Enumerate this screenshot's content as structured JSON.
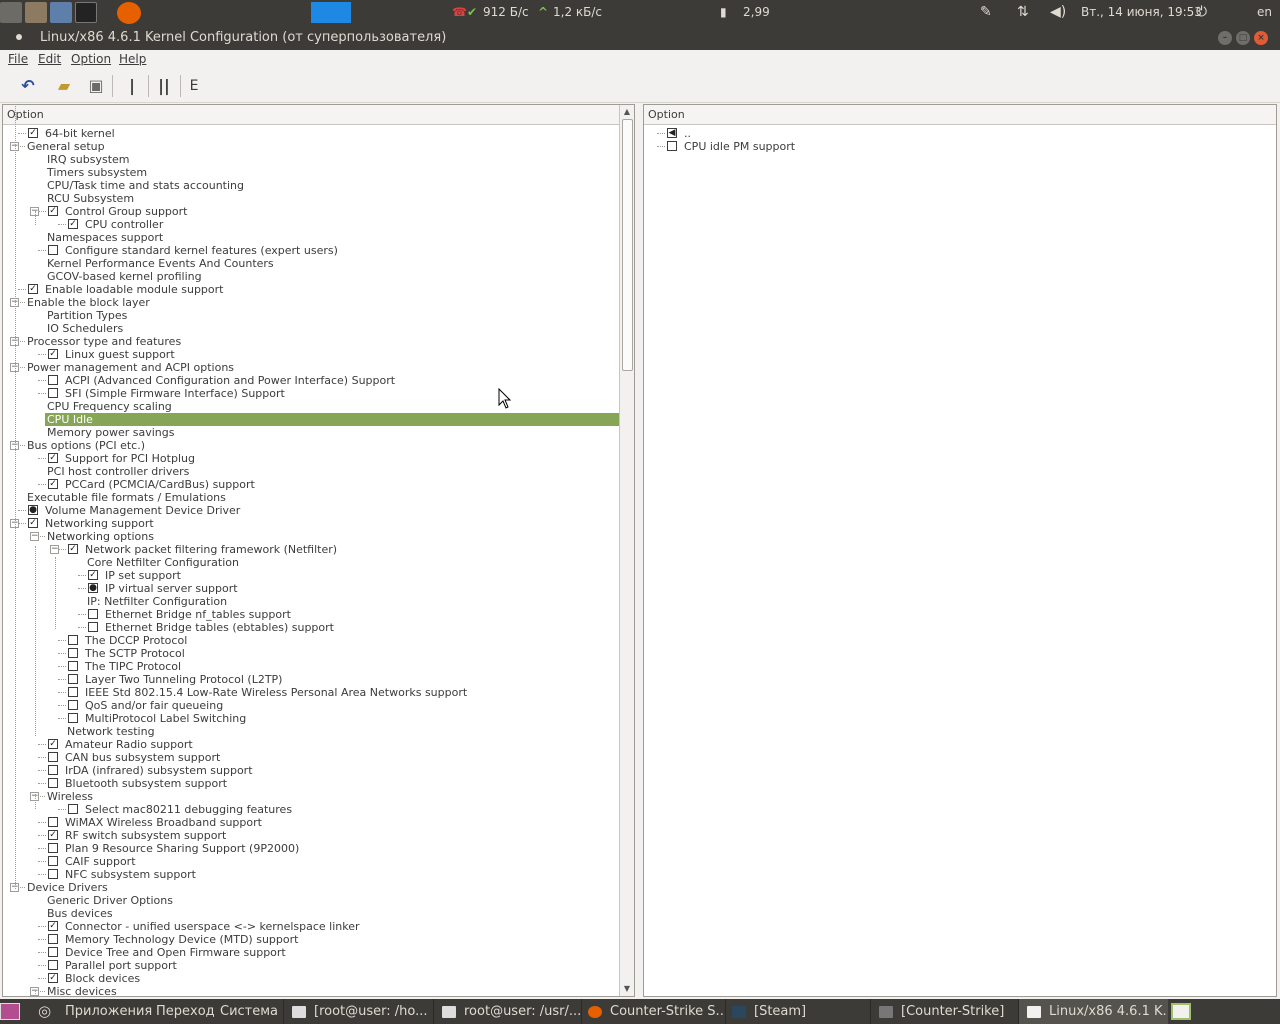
{
  "top_panel": {
    "net_down": "912 Б/с",
    "net_up": "1,2 кБ/с",
    "load": "2,99",
    "datetime": "Вт., 14 июня, 19:53",
    "keyboard_layout": "en"
  },
  "window": {
    "title": "Linux/x86 4.6.1 Kernel Configuration (от суперпользователя)"
  },
  "menu": {
    "file": "File",
    "edit": "Edit",
    "option": "Option",
    "help": "Help"
  },
  "toolbar": {
    "back": "back-arrow-icon",
    "load": "open-folder-icon",
    "save": "save-disk-icon",
    "single": "single-view-icon",
    "split": "split-view-icon",
    "full": "full-view-icon"
  },
  "left_pane": {
    "header": "Option",
    "rows": [
      {
        "label": "64-bit kernel",
        "check": "checked"
      },
      {
        "label": "General setup",
        "check": "none"
      },
      {
        "label": "IRQ subsystem",
        "check": "none"
      },
      {
        "label": "Timers subsystem",
        "check": "none"
      },
      {
        "label": "CPU/Task time and stats accounting",
        "check": "none"
      },
      {
        "label": "RCU Subsystem",
        "check": "none"
      },
      {
        "label": "Control Group support",
        "check": "checked"
      },
      {
        "label": "CPU controller",
        "check": "checked"
      },
      {
        "label": "Namespaces support",
        "check": "none"
      },
      {
        "label": "Configure standard kernel features (expert users)",
        "check": "unchecked"
      },
      {
        "label": "Kernel Performance Events And Counters",
        "check": "none"
      },
      {
        "label": "GCOV-based kernel profiling",
        "check": "none"
      },
      {
        "label": "Enable loadable module support",
        "check": "checked"
      },
      {
        "label": "Enable the block layer",
        "check": "none"
      },
      {
        "label": "Partition Types",
        "check": "none"
      },
      {
        "label": "IO Schedulers",
        "check": "none"
      },
      {
        "label": "Processor type and features",
        "check": "none"
      },
      {
        "label": "Linux guest support",
        "check": "checked"
      },
      {
        "label": "Power management and ACPI options",
        "check": "none"
      },
      {
        "label": "ACPI (Advanced Configuration and Power Interface) Support",
        "check": "unchecked"
      },
      {
        "label": "SFI (Simple Firmware Interface) Support",
        "check": "unchecked"
      },
      {
        "label": "CPU Frequency scaling",
        "check": "none"
      },
      {
        "label": "CPU Idle",
        "check": "none"
      },
      {
        "label": "Memory power savings",
        "check": "none"
      },
      {
        "label": "Bus options (PCI etc.)",
        "check": "none"
      },
      {
        "label": "Support for PCI Hotplug",
        "check": "checked"
      },
      {
        "label": "PCI host controller drivers",
        "check": "none"
      },
      {
        "label": "PCCard (PCMCIA/CardBus) support",
        "check": "checked"
      },
      {
        "label": "Executable file formats / Emulations",
        "check": "none"
      },
      {
        "label": "Volume Management Device Driver",
        "check": "module"
      },
      {
        "label": "Networking support",
        "check": "checked"
      },
      {
        "label": "Networking options",
        "check": "none"
      },
      {
        "label": "Network packet filtering framework (Netfilter)",
        "check": "checked"
      },
      {
        "label": "Core Netfilter Configuration",
        "check": "none"
      },
      {
        "label": "IP set support",
        "check": "checked"
      },
      {
        "label": "IP virtual server support",
        "check": "module"
      },
      {
        "label": "IP: Netfilter Configuration",
        "check": "none"
      },
      {
        "label": "Ethernet Bridge nf_tables support",
        "check": "unchecked"
      },
      {
        "label": "Ethernet Bridge tables (ebtables) support",
        "check": "unchecked"
      },
      {
        "label": "The DCCP Protocol",
        "check": "unchecked"
      },
      {
        "label": "The SCTP Protocol",
        "check": "unchecked"
      },
      {
        "label": "The TIPC Protocol",
        "check": "unchecked"
      },
      {
        "label": "Layer Two Tunneling Protocol (L2TP)",
        "check": "unchecked"
      },
      {
        "label": "IEEE Std 802.15.4 Low-Rate Wireless Personal Area Networks support",
        "check": "unchecked"
      },
      {
        "label": "QoS and/or fair queueing",
        "check": "unchecked"
      },
      {
        "label": "MultiProtocol Label Switching",
        "check": "unchecked"
      },
      {
        "label": "Network testing",
        "check": "none"
      },
      {
        "label": "Amateur Radio support",
        "check": "checked"
      },
      {
        "label": "CAN bus subsystem support",
        "check": "unchecked"
      },
      {
        "label": "IrDA (infrared) subsystem support",
        "check": "unchecked"
      },
      {
        "label": "Bluetooth subsystem support",
        "check": "unchecked"
      },
      {
        "label": "Wireless",
        "check": "none"
      },
      {
        "label": "Select mac80211 debugging features",
        "check": "unchecked"
      },
      {
        "label": "WiMAX Wireless Broadband support",
        "check": "unchecked"
      },
      {
        "label": "RF switch subsystem support",
        "check": "checked"
      },
      {
        "label": "Plan 9 Resource Sharing Support (9P2000)",
        "check": "unchecked"
      },
      {
        "label": "CAIF support",
        "check": "unchecked"
      },
      {
        "label": "NFC subsystem support",
        "check": "unchecked"
      },
      {
        "label": "Device Drivers",
        "check": "none"
      },
      {
        "label": "Generic Driver Options",
        "check": "none"
      },
      {
        "label": "Bus devices",
        "check": "none"
      },
      {
        "label": "Connector - unified userspace <-> kernelspace linker",
        "check": "checked"
      },
      {
        "label": "Memory Technology Device (MTD) support",
        "check": "unchecked"
      },
      {
        "label": "Device Tree and Open Firmware support",
        "check": "unchecked"
      },
      {
        "label": "Parallel port support",
        "check": "unchecked"
      },
      {
        "label": "Block devices",
        "check": "checked"
      },
      {
        "label": "Misc devices",
        "check": "none"
      }
    ]
  },
  "right_pane": {
    "header": "Option",
    "rows": [
      {
        "label": "..",
        "check": "back"
      },
      {
        "label": "CPU idle PM support",
        "check": "unchecked"
      }
    ]
  },
  "bottom_panel": {
    "apps": "Приложения",
    "places": "Переход",
    "system": "Система",
    "tasks": [
      "[root@user: /ho...",
      "root@user: /usr/...",
      "Counter-Strike S...",
      "[Steam]",
      "[Counter-Strike]",
      "Linux/x86 4.6.1 K..."
    ]
  }
}
